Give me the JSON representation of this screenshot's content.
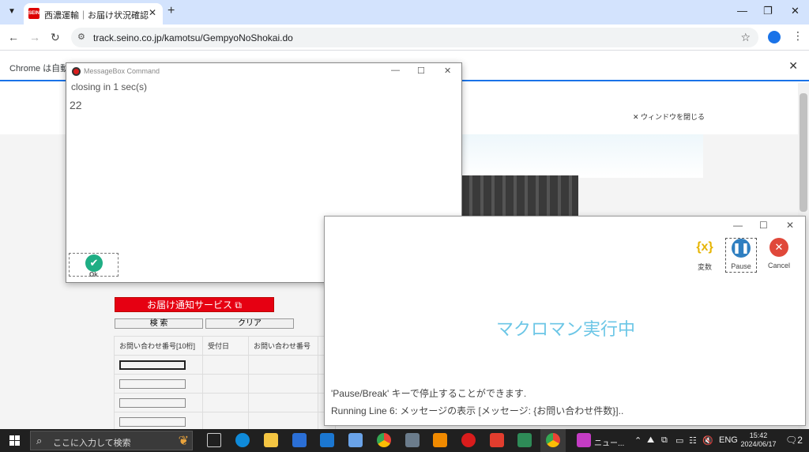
{
  "browser": {
    "tab_title": "西濃運輸｜お届け状況確認",
    "tab_favicon_text": "SEINO",
    "new_tab": "+",
    "url": "track.seino.co.jp/kamotsu/GempyoNoShokai.do",
    "infobar_text": "Chrome は自動テ",
    "window_controls": {
      "minimize": "—",
      "restore": "❐",
      "close": "✕"
    }
  },
  "webpage": {
    "close_window": "✕ ウィンドウを閉じる",
    "notify_service": "お届け通知サービス ⧉",
    "search_button": "検 索",
    "clear_button": "クリア",
    "table_headers": [
      "お問い合わせ番号[10桁]",
      "受付日",
      "お問い合わせ番号",
      "お"
    ]
  },
  "msgbox": {
    "title": "MessageBox Command",
    "closing_text": "closing in 1 sec(s)",
    "value": "22",
    "ok_label": "Ok"
  },
  "macroman": {
    "vars_label": "変数",
    "pause_label": "Pause",
    "cancel_label": "Cancel",
    "running_text": "マクロマン実行中",
    "hint": "'Pause/Break' キーで停止することができます.",
    "running_line": "Running Line 6: メッセージの表示 [メッセージ: {お問い合わせ件数}].."
  },
  "taskbar": {
    "search_placeholder": "ここに入力して検索",
    "news_label": "ニュー...",
    "language": "ENG",
    "time": "15:42",
    "date": "2024/06/17",
    "notification_count": "2"
  },
  "colors": {
    "accent": "#1a73e8",
    "ok_green": "#1fae84",
    "pause_blue": "#2f7fc1",
    "cancel_red": "#e0483a",
    "running_cyan": "#6cc6e6",
    "seino_red": "#e60012"
  }
}
